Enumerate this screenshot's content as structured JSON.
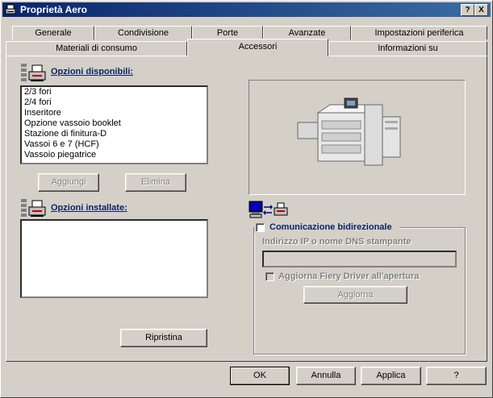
{
  "window": {
    "title": "Proprietà Aero"
  },
  "titlebar_buttons": {
    "help": "?",
    "close": "X"
  },
  "tabs_row1": [
    {
      "label": "Generale"
    },
    {
      "label": "Condivisione"
    },
    {
      "label": "Porte"
    },
    {
      "label": "Avanzate"
    },
    {
      "label": "Impostazioni periferica"
    }
  ],
  "tabs_row2": [
    {
      "label": "Materiali di consumo"
    },
    {
      "label": "Accessori"
    },
    {
      "label": "Informazioni su"
    }
  ],
  "available": {
    "label": "Opzioni disponibili:",
    "items": [
      "2/3 fori",
      "2/4 fori",
      "Inseritore",
      "Opzione vassoio booklet",
      "Stazione di finitura-D",
      "Vassoi 6 e 7 (HCF)",
      "Vassoio piegatrice"
    ],
    "add_button": "Aggiungi",
    "remove_button": "Elimina"
  },
  "installed": {
    "label": "Opzioni installate:",
    "items": [],
    "restore_button": "Ripristina"
  },
  "bidirectional": {
    "checkbox_label": "Comunicazione bidirezionale",
    "checked": false,
    "ip_label": "Indirizzo IP o nome DNS stampante",
    "ip_value": "",
    "update_on_open_label": "Aggiorna Fiery Driver all'apertura",
    "update_on_open_checked": false,
    "update_button": "Aggiorna"
  },
  "footer": {
    "ok": "OK",
    "cancel": "Annulla",
    "apply": "Applica",
    "help": "?"
  },
  "colors": {
    "titlebar": "#0a246a",
    "face": "#d4d0c8",
    "label_blue": "#0a246a"
  }
}
